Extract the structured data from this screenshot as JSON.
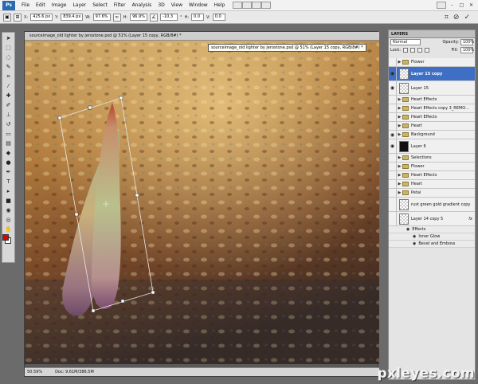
{
  "app": {
    "logo": "Ps",
    "menu": [
      "File",
      "Edit",
      "Image",
      "Layer",
      "Select",
      "Filter",
      "Analysis",
      "3D",
      "View",
      "Window",
      "Help"
    ]
  },
  "options_bar": {
    "x_label": "X:",
    "x_value": "425.6 px",
    "y_label": "Y:",
    "y_value": "839.4 px",
    "w_label": "W:",
    "w_value": "97.6%",
    "h_label": "H:",
    "h_value": "96.9%",
    "angle_value": "-10.3",
    "hskew_label": "H:",
    "hskew_value": "0.0",
    "vskew_label": "V:",
    "vskew_value": "0.0",
    "angle_unit": "°"
  },
  "document": {
    "tab_title": "sourceimage_old lighter by jerostone.psd @ 51% (Layer 15 copy, RGB/8#) *",
    "float_title": "sourceimage_old lighter by jerostone.psd @ 51% (Layer 15 copy, RGB/8#) *",
    "zoom": "50.59%",
    "doc_size": "Doc: 9.61M/386.5M"
  },
  "layers_panel": {
    "tab": "LAYERS",
    "blend_mode": "Normal",
    "opacity_label": "Opacity:",
    "opacity_value": "100%",
    "lock_label": "Lock:",
    "fill_label": "Fill:",
    "fill_value": "100%",
    "layers": [
      {
        "name": "Flower",
        "kind": "group"
      },
      {
        "name": "Layer 15 copy",
        "kind": "layer",
        "selected": true
      },
      {
        "name": "Layer 15",
        "kind": "layer"
      },
      {
        "name": "Heart Effects",
        "kind": "group"
      },
      {
        "name": "Heart Effects copy 3_REMO...",
        "kind": "group"
      },
      {
        "name": "Heart Effects",
        "kind": "group"
      },
      {
        "name": "Heart",
        "kind": "group"
      },
      {
        "name": "Background",
        "kind": "group"
      },
      {
        "name": "Layer 6",
        "kind": "layer"
      },
      {
        "name": "Selections",
        "kind": "group"
      },
      {
        "name": "Flower",
        "kind": "group"
      },
      {
        "name": "Heart Effects",
        "kind": "group"
      },
      {
        "name": "Heart",
        "kind": "group"
      },
      {
        "name": "Petal",
        "kind": "group"
      },
      {
        "name": "rust green gold gradient copy",
        "kind": "layer"
      },
      {
        "name": "Layer 14 copy 5",
        "kind": "layer",
        "fx": "fx"
      }
    ],
    "effects_label": "Effects",
    "effects": [
      "Inner Glow",
      "Bevel and Emboss"
    ]
  },
  "watermark": "pxleyes.com",
  "colors": {
    "foreground": "#e00000",
    "background": "#ffffff",
    "selection": "#3e6fc4"
  }
}
